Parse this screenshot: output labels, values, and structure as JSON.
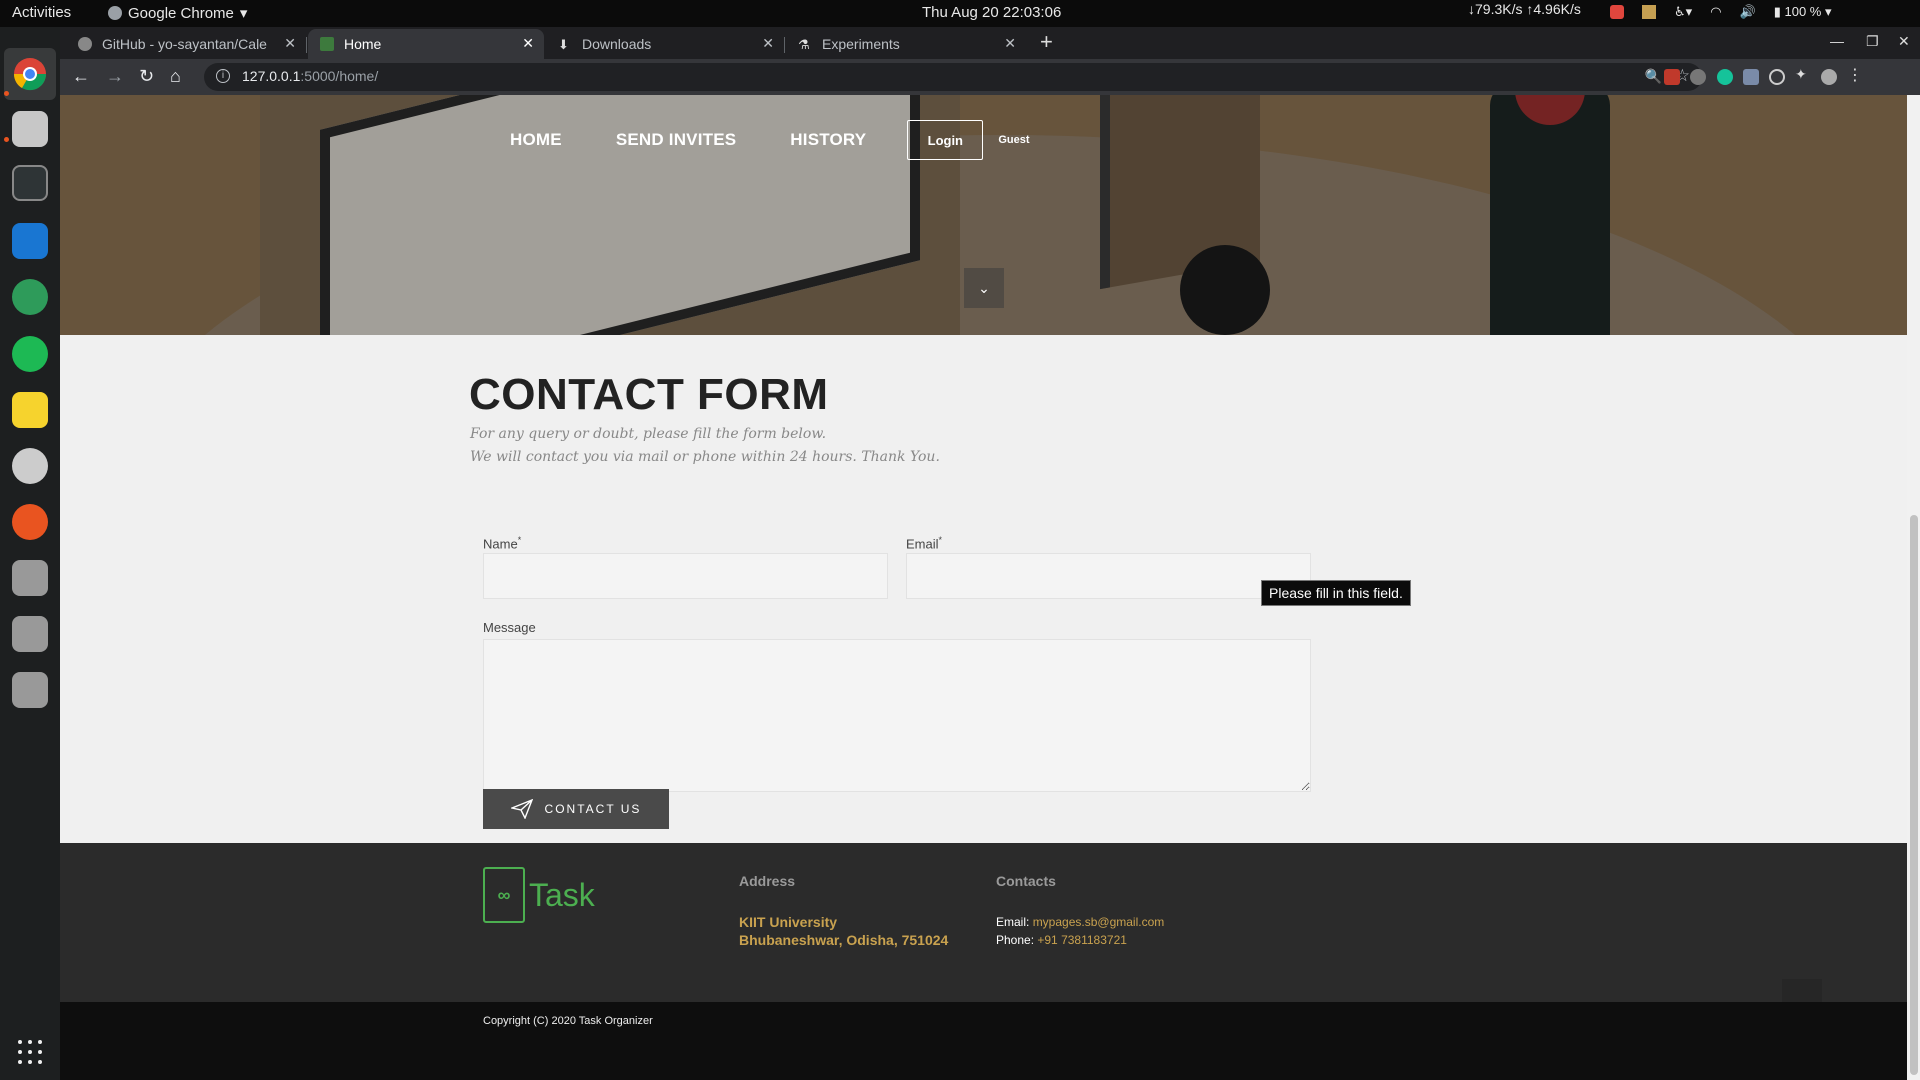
{
  "desktop": {
    "activities": "Activities",
    "app_name": "Google Chrome",
    "clock": "Thu Aug 20  22:03:06",
    "net_speed": "↓79.3K/s ↑4.96K/s",
    "battery": "100 %"
  },
  "browser": {
    "tabs": [
      {
        "title": "GitHub - yo-sayantan/Cale",
        "favicon": "github-icon"
      },
      {
        "title": "Home",
        "favicon": "task-logo-icon"
      },
      {
        "title": "Downloads",
        "favicon": "download-icon"
      },
      {
        "title": "Experiments",
        "favicon": "flask-icon"
      }
    ],
    "url_host": "127.0.0.1",
    "url_rest": ":5000/home/"
  },
  "nav": {
    "home": "HOME",
    "send_invites": "SEND INVITES",
    "history": "HISTORY",
    "login": "Login",
    "guest": "Guest"
  },
  "contact": {
    "title": "CONTACT FORM",
    "subtitle_line1": "For any query or doubt, please fill the form below.",
    "subtitle_line2": "We will contact you via mail or phone within 24 hours. Thank You.",
    "name_label": "Name",
    "email_label": "Email",
    "required_mark": "*",
    "message_label": "Message",
    "name_value": "",
    "email_value": "",
    "message_value": "",
    "validation_tooltip": "Please fill in this field.",
    "submit_label": "CONTACT US"
  },
  "footer": {
    "brand": "Task",
    "address_heading": "Address",
    "address_line1": "KIIT University",
    "address_line2": "Bhubaneshwar, Odisha, 751024",
    "contacts_heading": "Contacts",
    "email_label": "Email: ",
    "email_value": "mypages.sb@gmail.com",
    "phone_label": "Phone: ",
    "phone_value": "+91 7381183721",
    "copyright": "Copyright (C) 2020 Task Organizer"
  },
  "colors": {
    "accent_green": "#4caf50",
    "accent_gold": "#c9a24f",
    "footer_bg": "#2b2b2b"
  }
}
